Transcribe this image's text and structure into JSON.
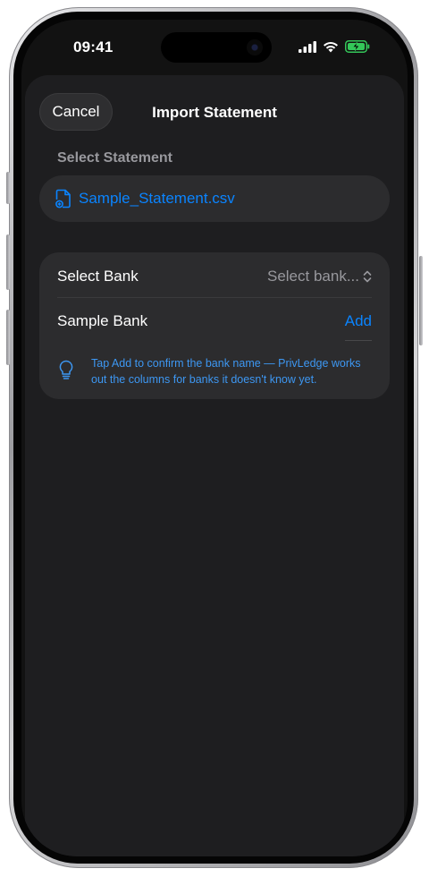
{
  "status_bar": {
    "time": "09:41"
  },
  "nav": {
    "cancel_label": "Cancel",
    "title": "Import Statement"
  },
  "statement": {
    "section_header": "Select Statement",
    "file_name": "Sample_Statement.csv"
  },
  "bank": {
    "picker_label": "Select Bank",
    "picker_value": "Select bank...",
    "suggested_bank": "Sample Bank",
    "add_label": "Add",
    "hint": "Tap Add to confirm the bank name — PrivLedge works out the columns for banks it doesn't know yet."
  },
  "colors": {
    "accent": "#0a84ff",
    "background": "#1e1e20",
    "card": "#2c2c2e",
    "secondary_text": "#98989d"
  },
  "icons": [
    "signal-icon",
    "wifi-icon",
    "battery-charging-icon",
    "document-icon",
    "chevron-up-down-icon",
    "lightbulb-icon"
  ]
}
